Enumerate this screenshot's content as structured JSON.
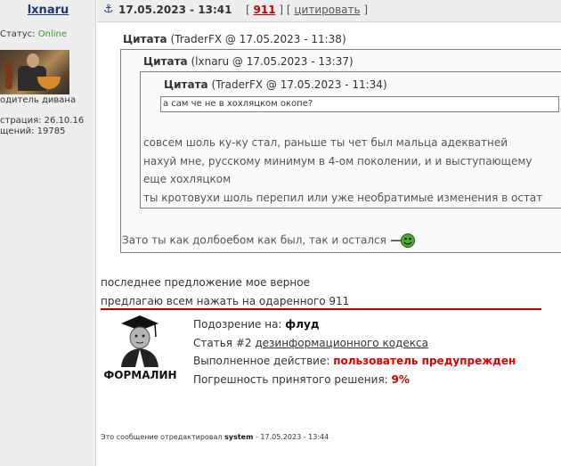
{
  "author": {
    "name": "lxnaru",
    "status_label": "Статус: ",
    "status_value": "Online",
    "rank": "одитель дивана",
    "registered": "страция: 26.10.16",
    "posts": "щений: 19785"
  },
  "header": {
    "date": "17.05.2023 - 13:41",
    "bracket_open": "[ ",
    "post_number": "911",
    "sep": " ] [ ",
    "quote_link": "цитировать",
    "bracket_close": " ]"
  },
  "quotes": {
    "outer": {
      "label": "Цитата",
      "meta": " (TraderFX @ 17.05.2023 - 11:38)",
      "text": "Зато ты как долбоебом как был, так и остался"
    },
    "middle": {
      "label": "Цитата",
      "meta": " (lxnaru @ 17.05.2023 - 13:37)",
      "lines": [
        "совсем шоль ку-ку стал, раньше ты чет был мальца адекватней",
        "нахуй мне, русскому минимум в 4-ом поколении, и и выступающему",
        "еще хохляцком",
        "ты кротовухи шоль перепил или уже необратимые изменения в остат"
      ]
    },
    "inner": {
      "label": "Цитата",
      "meta": " (TraderFX @ 17.05.2023 - 11:34)",
      "text": "а сам че не в хохляцком окопе?"
    }
  },
  "body": {
    "lines": [
      "последнее предложение мое верное",
      "предлагаю всем нажать на одаренного 911"
    ]
  },
  "moderation": {
    "moderator_name": "ФОРМАЛИН",
    "suspicion_label": "Подозрение на: ",
    "suspicion_value": "флуд",
    "article_prefix": "Статья #2 ",
    "article_link": "дезинформационного кодекса",
    "action_label": "Выполненное действие: ",
    "action_value": "пользователь предупрежден",
    "error_label": "Погрешность принятого решения: ",
    "error_value": "9%"
  },
  "edited": {
    "prefix": "Это сообщение отредактировал ",
    "user": "system",
    "suffix": " - 17.05.2023 - 13:44"
  },
  "colors": {
    "online": "#2e9e1f",
    "accent_red": "#c40000",
    "action_red": "#e00000",
    "link_blue": "#1b3a7a"
  },
  "icons": [
    "anchor-icon",
    "smiley-icon",
    "moderator-avatar"
  ]
}
